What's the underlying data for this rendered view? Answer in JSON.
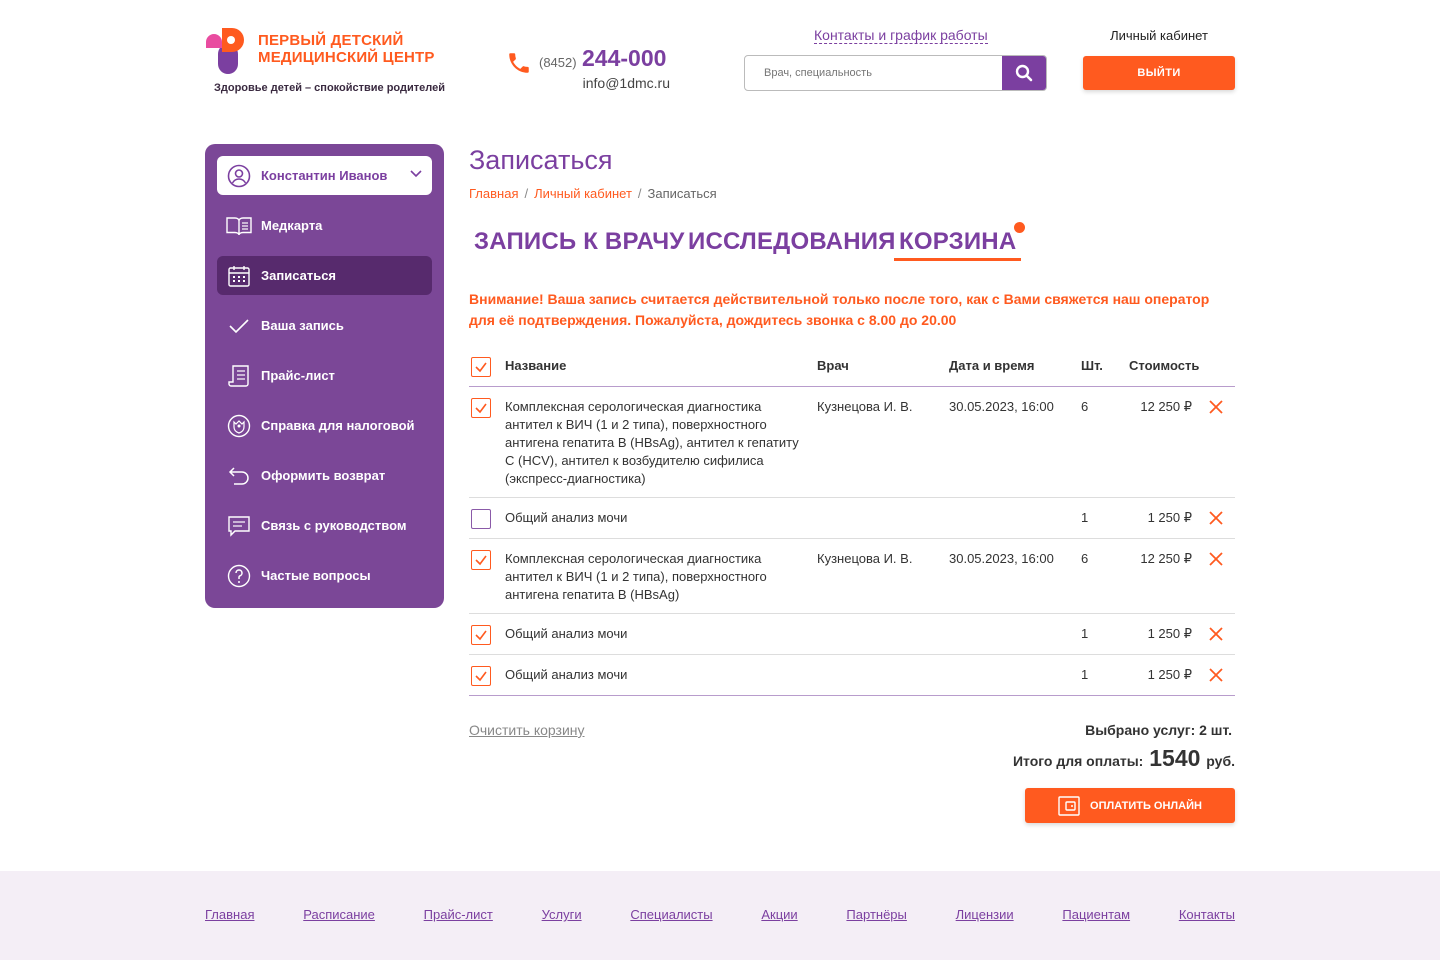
{
  "header": {
    "logo_title_line1": "ПЕРВЫЙ ДЕТСКИЙ",
    "logo_title_line2": "МЕДИЦИНСКИЙ ЦЕНТР",
    "logo_tagline": "Здоровье детей – спокойствие родителей",
    "phone_code": "(8452)",
    "phone_number": "244-000",
    "email": "info@1dmc.ru",
    "contacts_link": "Контакты и график работы",
    "search_placeholder": "Врач, специальность",
    "cabinet_label": "Личный кабинет",
    "logout_label": "ВЫЙТИ"
  },
  "sidebar": {
    "user_name": "Константин Иванов",
    "items": [
      {
        "label": "Медкарта",
        "icon": "book-icon"
      },
      {
        "label": "Записаться",
        "icon": "calendar-icon",
        "active": true
      },
      {
        "label": "Ваша запись",
        "icon": "checkmark-icon"
      },
      {
        "label": "Прайс-лист",
        "icon": "receipt-icon"
      },
      {
        "label": "Справка для налоговой",
        "icon": "emblem-icon"
      },
      {
        "label": "Оформить возврат",
        "icon": "return-arrow-icon"
      },
      {
        "label": "Связь с руководством",
        "icon": "message-icon"
      },
      {
        "label": "Частые вопросы",
        "icon": "question-icon"
      }
    ]
  },
  "main": {
    "title": "Записаться",
    "breadcrumb": [
      "Главная",
      "Личный кабинет",
      "Записаться"
    ],
    "tabs": [
      "ЗАПИСЬ К ВРАЧУ",
      "ИССЛЕДОВАНИЯ",
      "КОРЗИНА"
    ],
    "notice": "Внимание! Ваша запись считается действительной только после того, как с Вами свяжется наш оператор для её подтверждения. Пожалуйста, дождитесь звонка с 8.00 до 20.00",
    "table": {
      "headers": [
        "Название",
        "Врач",
        "Дата и время",
        "Шт.",
        "Стоимость"
      ],
      "rows": [
        {
          "checked": true,
          "name_lines": [
            "Комплексная серологическая диагностика",
            "антител к ВИЧ (1 и 2 типа), поверхностного",
            "антигена гепатита В (HBsAg), антител к гепатиту",
            "С (HCV), антител к возбудителю сифилиса",
            "(экспресс-диагностика)"
          ],
          "doctor": "Кузнецова И. В.",
          "datetime": "30.05.2023, 16:00",
          "qty": "6",
          "price": "12 250 ₽"
        },
        {
          "checked": false,
          "name_lines": [
            "Общий анализ мочи"
          ],
          "doctor": "",
          "datetime": "",
          "qty": "1",
          "price": "1 250 ₽"
        },
        {
          "checked": true,
          "name_lines": [
            "Комплексная серологическая диагностика",
            "антител к ВИЧ (1 и 2 типа), поверхностного",
            "антигена гепатита В (HBsAg)"
          ],
          "doctor": "Кузнецова И. В.",
          "datetime": "30.05.2023, 16:00",
          "qty": "6",
          "price": "12 250 ₽"
        },
        {
          "checked": true,
          "name_lines": [
            "Общий анализ мочи"
          ],
          "doctor": "",
          "datetime": "",
          "qty": "1",
          "price": "1 250 ₽"
        },
        {
          "checked": true,
          "name_lines": [
            "Общий анализ мочи"
          ],
          "doctor": "",
          "datetime": "",
          "qty": "1",
          "price": "1 250 ₽"
        }
      ]
    },
    "clear_cart": "Очистить корзину",
    "selected_label": "Выбрано услуг: 2 шт.",
    "total_label": "Итого для оплаты:",
    "total_amount": "1540",
    "total_currency": "руб.",
    "pay_button": "ОПЛАТИТЬ ОНЛАЙН"
  },
  "footer": {
    "links": [
      "Главная",
      "Расписание",
      "Прайс-лист",
      "Услуги",
      "Специалисты",
      "Акции",
      "Партнёры",
      "Лицензии",
      "Пациентам",
      "Контакты"
    ]
  },
  "colors": {
    "accent": "#ff5a1f",
    "brand": "#7b3fa0",
    "sidebar_bg": "#7b4797",
    "sidebar_active": "#572a6d",
    "footer_bg": "#f4eef6"
  }
}
